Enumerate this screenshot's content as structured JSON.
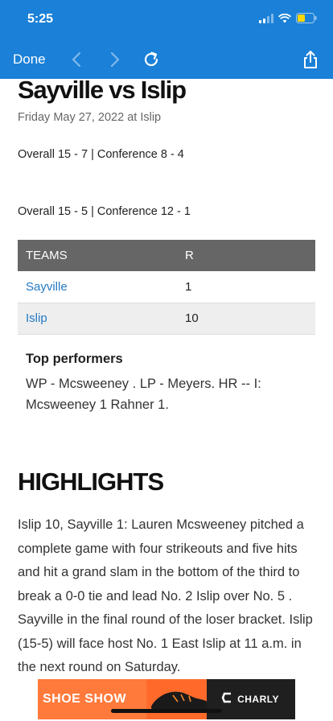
{
  "status_bar": {
    "time": "5:25"
  },
  "toolbar": {
    "done_label": "Done"
  },
  "game": {
    "title": "Sayville vs Islip",
    "date": "Friday May 27, 2022 at Islip",
    "record_1": "Overall 15 - 7 | Conference 8 - 4",
    "record_2": "Overall 15 - 5 | Conference 12 - 1"
  },
  "score_table": {
    "headers": [
      "TEAMS",
      "R"
    ],
    "rows": [
      {
        "team": "Sayville",
        "runs": "1"
      },
      {
        "team": "Islip",
        "runs": "10"
      }
    ]
  },
  "top_performers": {
    "title": "Top performers",
    "text": "WP - Mcsweeney . LP - Meyers. HR -- I: Mcsweeney  1 Rahner  1."
  },
  "highlights": {
    "title": "HIGHLIGHTS",
    "body": "Islip 10, Sayville 1: Lauren Mcsweeney pitched a complete game with four strikeouts and five hits and hit a grand slam in the bottom of the third to break a 0-0 tie and lead No. 2 Islip over No. 5 . Sayville in the final round of the loser bracket. Islip (15-5) will face host No. 1 East Islip at 11 a.m. in the next round on Saturday."
  },
  "ad": {
    "left_text": "SHOE SHOW",
    "brand": "CHARLY"
  },
  "colors": {
    "accent": "#1a80d8",
    "link": "#2479c4",
    "table_header": "#666666"
  }
}
